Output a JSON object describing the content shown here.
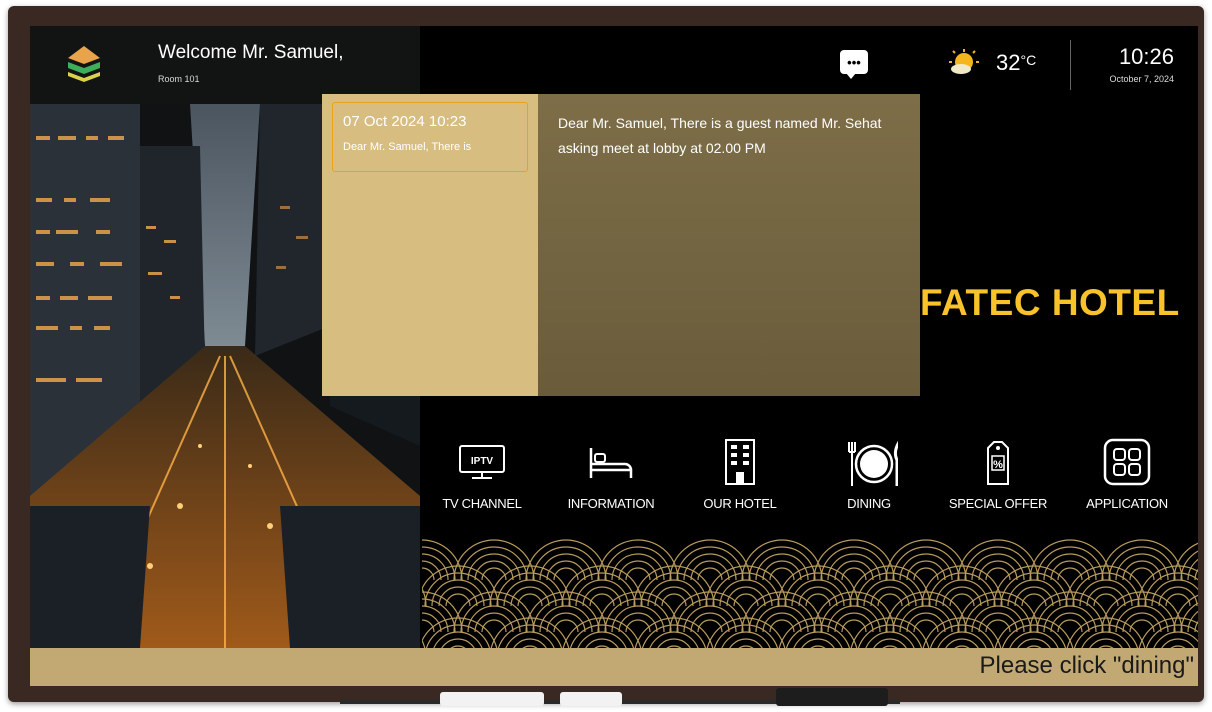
{
  "header": {
    "welcome": "Welcome Mr. Samuel,",
    "room": "Room 101",
    "temperature": "32",
    "temperature_unit": "°C",
    "time": "10:26",
    "date": "October 7, 2024",
    "message_icon": "chat-bubble-icon",
    "weather_icon": "sun-cloud-icon"
  },
  "hotel": {
    "name": "FATEC HOTEL",
    "accent_color": "#f7c22a"
  },
  "notification": {
    "list_item": {
      "datetime": "07 Oct 2024 10:23",
      "preview": "Dear Mr. Samuel, There is"
    },
    "message": "Dear Mr. Samuel, There is a guest named Mr. Sehat asking meet at lobby at 02.00 PM"
  },
  "menu": [
    {
      "label": "TV CHANNEL",
      "icon": "tv-iptv-icon",
      "icon_text": "IPTV"
    },
    {
      "label": "INFORMATION",
      "icon": "bed-icon"
    },
    {
      "label": "OUR HOTEL",
      "icon": "building-icon"
    },
    {
      "label": "DINING",
      "icon": "plate-cutlery-icon"
    },
    {
      "label": "SPECIAL OFFER",
      "icon": "price-tag-icon",
      "icon_text": "%"
    },
    {
      "label": "APPLICATION",
      "icon": "apps-grid-icon"
    }
  ],
  "ticker": {
    "text": "Please click \"dining\""
  },
  "colors": {
    "ticker_bg": "#c2a973",
    "popup_list_bg": "#d8bd80",
    "popup_detail_bg": "#7d6e48",
    "selection_border": "#e8a31d"
  }
}
